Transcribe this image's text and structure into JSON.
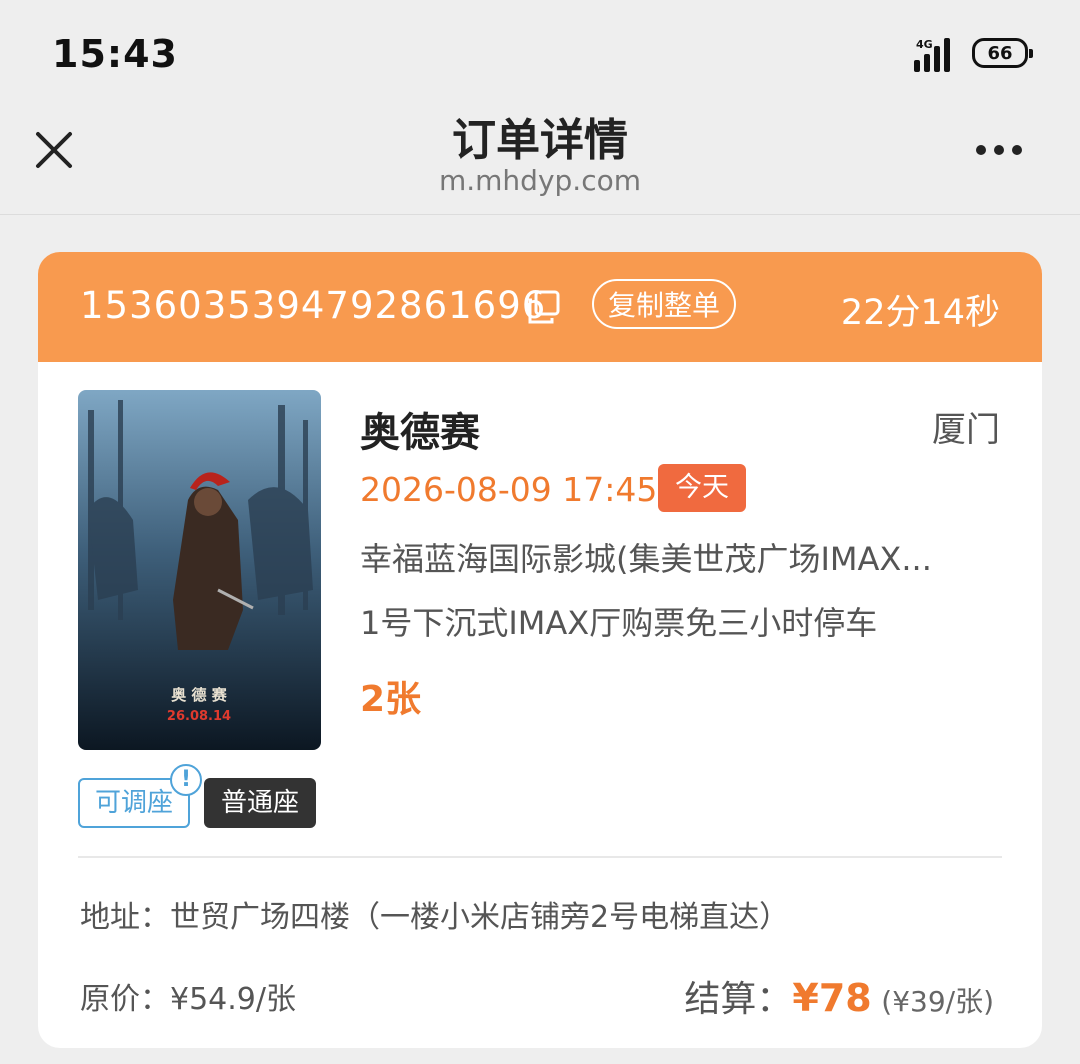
{
  "status_bar": {
    "time": "15:43",
    "network": "4G",
    "battery": "66"
  },
  "header": {
    "title": "订单详情",
    "url": "m.mhdyp.com"
  },
  "order": {
    "number": "1536035394792861696",
    "copy_all_label": "复制整单",
    "countdown": "22分14秒"
  },
  "movie": {
    "name": "奥德赛",
    "city": "厦门",
    "showtime": "2026-08-09 17:45",
    "day_badge": "今天",
    "cinema": "幸福蓝海国际影城(集美世茂广场IMAX...",
    "hall": "1号下沉式IMAX厅购票免三小时停车",
    "ticket_count": "2张",
    "poster": {
      "title": "奥 德 赛",
      "date": "26.08.14"
    }
  },
  "tags": {
    "adjustable": "可调座",
    "info_mark": "!",
    "seat_type": "普通座"
  },
  "address": "地址：世贸广场四楼（一楼小米店铺旁2号电梯直达）",
  "pricing": {
    "original": "原价：¥54.9/张",
    "settle_label": "结算：",
    "settle_amount": "¥78",
    "per_ticket": "(¥39/张)"
  },
  "colors": {
    "accent": "#f89a4f",
    "price": "#f07a2e",
    "badge": "#f06a3f",
    "link": "#4fa3d9"
  }
}
